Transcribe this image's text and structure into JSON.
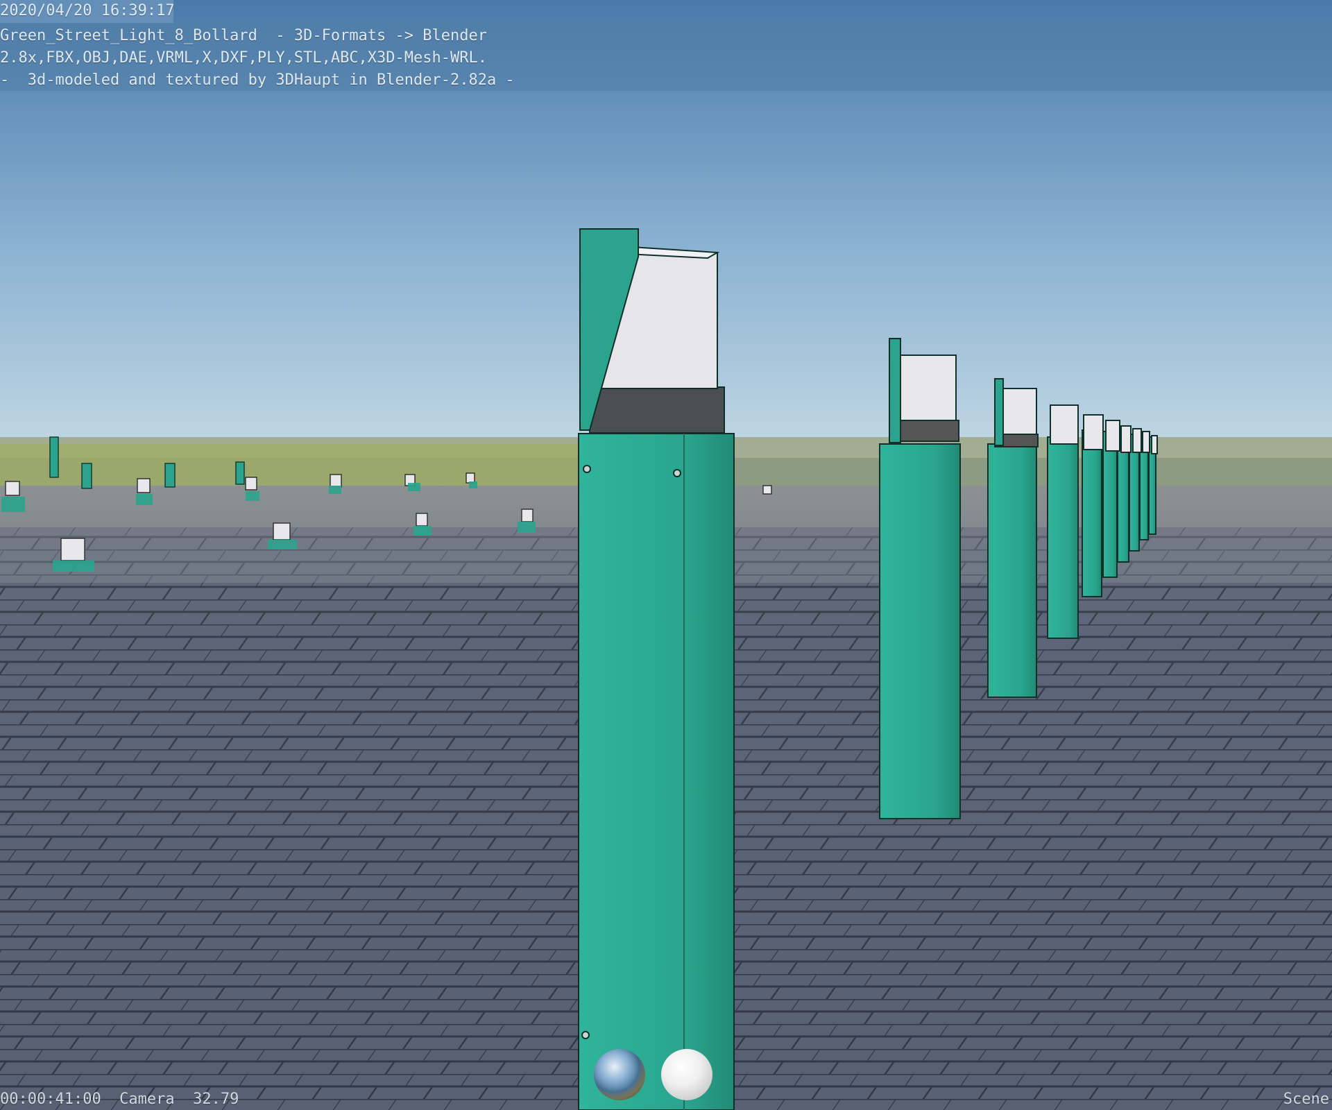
{
  "header": {
    "timestamp": "2020/04/20 16:39:17",
    "line1": "Green_Street_Light_8_Bollard  - 3D-Formats -> Blender",
    "line2": "2.8x,FBX,OBJ,DAE,VRML,X,DXF,PLY,STL,ABC,X3D-Mesh-WRL.",
    "line3": "-  3d-modeled and textured by 3DHaupt in Blender-2.82a -"
  },
  "status_bar": {
    "left": "00:00:41:00  Camera  32.79",
    "right": "Scene"
  },
  "viewport": {
    "bollard_color": "#2bb39a",
    "sky_top": "#4f7fae",
    "sky_bottom": "#b9d2e2",
    "ground_color": "#5b6478",
    "lamp_color": "#e6e6e8"
  },
  "preview_spheres": {
    "hdri_icon": "world-hdri-sphere",
    "matcap_icon": "white-matcap-sphere"
  }
}
